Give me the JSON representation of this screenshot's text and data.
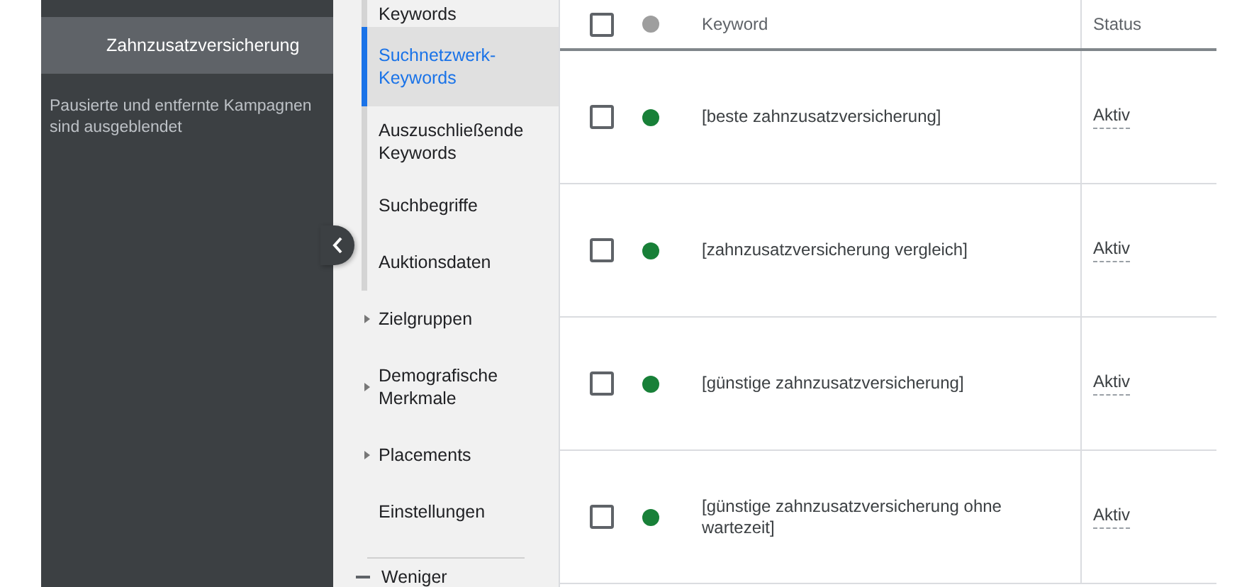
{
  "sidebar": {
    "items": [
      {
        "label": "Zahnzusatzversicherung",
        "selected": true
      }
    ],
    "note": "Pausierte und entfernte Kampagnen sind ausgeblendet"
  },
  "nav": {
    "items": [
      {
        "label": "Keywords",
        "kind": "child",
        "selected": false
      },
      {
        "label": "Suchnetzwerk-Keywords",
        "kind": "child",
        "selected": true
      },
      {
        "label": "Auszuschließende Keywords",
        "kind": "child",
        "selected": false
      },
      {
        "label": "Suchbegriffe",
        "kind": "child",
        "selected": false
      },
      {
        "label": "Auktionsdaten",
        "kind": "child",
        "selected": false
      },
      {
        "label": "Zielgruppen",
        "kind": "group",
        "expanded": false,
        "selected": false
      },
      {
        "label": "Demografische Merkmale",
        "kind": "group",
        "expanded": false,
        "selected": false
      },
      {
        "label": "Placements",
        "kind": "group",
        "expanded": false,
        "selected": false
      },
      {
        "label": "Einstellungen",
        "kind": "plain",
        "selected": false
      }
    ],
    "toggle": {
      "label": "Weniger"
    }
  },
  "table": {
    "header": {
      "checked": false,
      "color": "#9e9e9e"
    },
    "columns": [
      "Keyword",
      "Status"
    ],
    "rows": [
      {
        "checked": false,
        "color": "#188038",
        "keyword": "[beste zahnzusatzversicherung]",
        "status": "Aktiv"
      },
      {
        "checked": false,
        "color": "#188038",
        "keyword": "[zahnzusatzversicherung vergleich]",
        "status": "Aktiv"
      },
      {
        "checked": false,
        "color": "#188038",
        "keyword": "[günstige zahnzusatzversicherung]",
        "status": "Aktiv"
      },
      {
        "checked": false,
        "color": "#188038",
        "keyword": "[günstige zahnzusatzversicherung ohne wartezeit]",
        "status": "Aktiv"
      }
    ]
  }
}
